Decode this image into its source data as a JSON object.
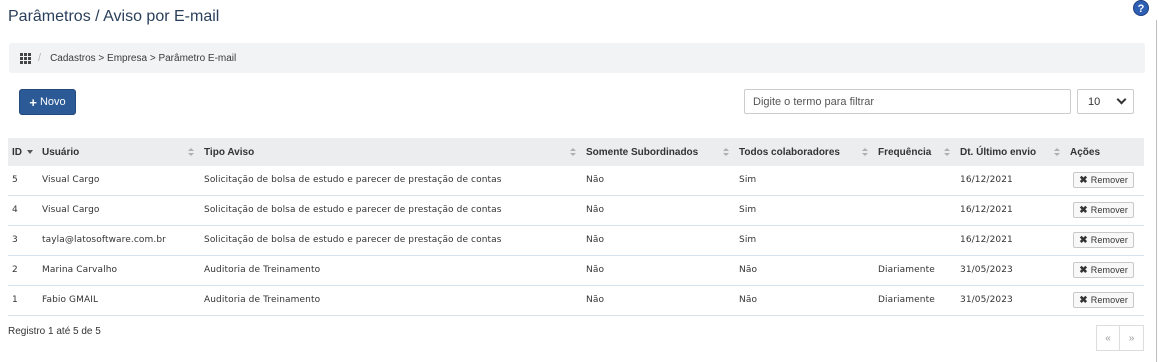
{
  "page": {
    "title": "Parâmetros / Aviso por E-mail",
    "help_icon": "?"
  },
  "breadcrumb": {
    "separator": "/",
    "path": "Cadastros > Empresa > Parâmetro E-mail"
  },
  "toolbar": {
    "new_button": {
      "icon": "+",
      "label": "Novo"
    },
    "filter": {
      "placeholder": "Digite o termo para filtrar",
      "value": ""
    },
    "page_size": "10"
  },
  "table": {
    "columns": [
      "ID",
      "Usuário",
      "Tipo Aviso",
      "Somente Subordinados",
      "Todos colaboradores",
      "Frequência",
      "Dt. Último envio",
      "Ações"
    ],
    "rows": [
      {
        "id": "5",
        "usuario": "Visual Cargo",
        "tipo": "Solicitação de bolsa de estudo e parecer de prestação de contas",
        "subordinados": "Não",
        "todos": "Sim",
        "frequencia": "",
        "ultimo_envio": "16/12/2021",
        "acao": "Remover"
      },
      {
        "id": "4",
        "usuario": "Visual Cargo",
        "tipo": "Solicitação de bolsa de estudo e parecer de prestação de contas",
        "subordinados": "Não",
        "todos": "Sim",
        "frequencia": "",
        "ultimo_envio": "16/12/2021",
        "acao": "Remover"
      },
      {
        "id": "3",
        "usuario": "tayla@latosoftware.com.br",
        "tipo": "Solicitação de bolsa de estudo e parecer de prestação de contas",
        "subordinados": "Não",
        "todos": "Sim",
        "frequencia": "",
        "ultimo_envio": "16/12/2021",
        "acao": "Remover"
      },
      {
        "id": "2",
        "usuario": "Marina Carvalho",
        "tipo": "Auditoria de Treinamento",
        "subordinados": "Não",
        "todos": "Não",
        "frequencia": "Diariamente",
        "ultimo_envio": "31/05/2023",
        "acao": "Remover"
      },
      {
        "id": "1",
        "usuario": "Fabio GMAIL",
        "tipo": "Auditoria de Treinamento",
        "subordinados": "Não",
        "todos": "Não",
        "frequencia": "Diariamente",
        "ultimo_envio": "31/05/2023",
        "acao": "Remover"
      }
    ],
    "remove_icon": "✖"
  },
  "footer": {
    "info": "Registro 1 até 5 de 5",
    "prev": "«",
    "next": "»"
  }
}
